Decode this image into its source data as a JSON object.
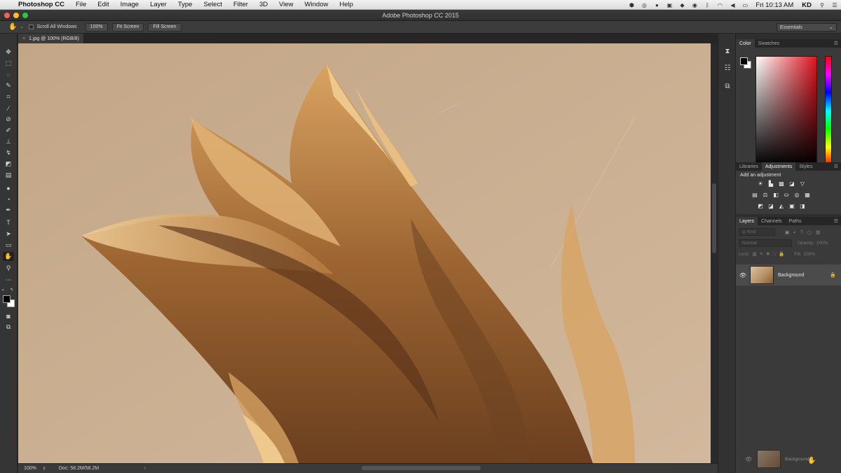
{
  "menubar": {
    "apple": "",
    "app": "Photoshop CC",
    "items": [
      "File",
      "Edit",
      "Image",
      "Layer",
      "Type",
      "Select",
      "Filter",
      "3D",
      "View",
      "Window",
      "Help"
    ],
    "clock": "Fri 10:13 AM",
    "user": "KD"
  },
  "window": {
    "title": "Adobe Photoshop CC 2015"
  },
  "options": {
    "scroll_all": "Scroll All Windows",
    "zoom_btn": "100%",
    "fit_btn": "Fit Screen",
    "fill_btn": "Fill Screen",
    "workspace": "Essentials"
  },
  "document": {
    "tab": "1.jpg @ 100% (RGB/8)"
  },
  "status": {
    "zoom": "100%",
    "doc": "Doc: 58.2M/58.2M"
  },
  "panels": {
    "color_tabs": [
      "Color",
      "Swatches"
    ],
    "adj_tabs": [
      "Libraries",
      "Adjustments",
      "Styles"
    ],
    "adj_hint": "Add an adjustment",
    "layers_tabs": [
      "Layers",
      "Channels",
      "Paths"
    ],
    "kind_placeholder": "Kind",
    "blend_mode": "Normal",
    "opacity_label": "Opacity:",
    "opacity_value": "100%",
    "lock_label": "Lock:",
    "fill_label": "Fill:",
    "fill_value": "100%"
  },
  "layers": [
    {
      "name": "Background"
    }
  ],
  "drag_ghost": {
    "name": "Background"
  },
  "colors": {
    "accent_red": "#e0141e",
    "canvas_bg": "#c7ab8e"
  }
}
